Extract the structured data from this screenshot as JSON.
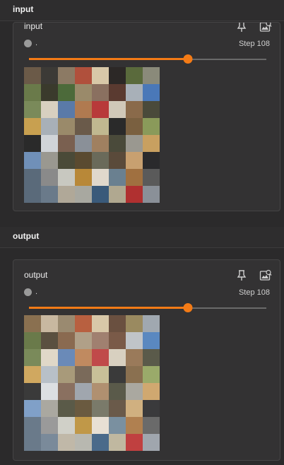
{
  "sections": [
    {
      "header": "input",
      "card": {
        "title": "input",
        "run_label": ".",
        "step_label": "Step 108",
        "slider_fraction": 0.67,
        "icons": [
          "pin-icon",
          "image-settings-icon"
        ],
        "tile_colors": [
          "#6b5a48",
          "#3c3a36",
          "#8c7a64",
          "#b0503c",
          "#d8c8a8",
          "#2c2826",
          "#5a6a3c",
          "#8a8a7a",
          "#6a7a4a",
          "#3a3a2c",
          "#4c6a3a",
          "#9a8a6a",
          "#8a7060",
          "#5a3a30",
          "#a8b0b8",
          "#4a78b8",
          "#7a8a5a",
          "#d8d0c0",
          "#5a7aa8",
          "#b07a50",
          "#b83a3a",
          "#d0c8b8",
          "#8a6a4a",
          "#4a4a3a",
          "#c8a050",
          "#a8b0b8",
          "#9a8a6a",
          "#6a5a4a",
          "#c0b890",
          "#2a2a2a",
          "#7a6040",
          "#8a9a5a",
          "#2a2a2a",
          "#d0d4d8",
          "#7a6050",
          "#8a9098",
          "#a08060",
          "#4a4a3a",
          "#9a9890",
          "#c8a060",
          "#7090b8",
          "#9a9890",
          "#4a4a38",
          "#5a4a30",
          "#6a6a5a",
          "#5a4a3a",
          "#c8a070",
          "#2a2a2c",
          "#5a6a7a",
          "#8a8a8a",
          "#c8c8c0",
          "#b88838",
          "#e0d8cc",
          "#6a8090",
          "#a07040",
          "#5a5a5a",
          "#5a6a7a",
          "#6a7a8a",
          "#b0a898",
          "#a8a8a0",
          "#3a5a7a",
          "#b0a890",
          "#b03030",
          "#8a9098"
        ]
      }
    },
    {
      "header": "output",
      "card": {
        "title": "output",
        "run_label": ".",
        "step_label": "Step 108",
        "slider_fraction": 0.67,
        "icons": [
          "pin-icon",
          "image-settings-icon"
        ],
        "tile_colors": [
          "#8a7050",
          "#c8b8a0",
          "#9a8a70",
          "#b86040",
          "#d8c8a8",
          "#6a5040",
          "#9a8a60",
          "#a0a8b0",
          "#6a7a4a",
          "#5a5040",
          "#8a6a50",
          "#b0a088",
          "#a08070",
          "#7a5a48",
          "#c0c4c8",
          "#5a88c0",
          "#7a8a5a",
          "#e0d8c8",
          "#6a8ab8",
          "#c08a60",
          "#c04a4a",
          "#d8d0c0",
          "#9a7a5a",
          "#5a5a4a",
          "#d0a860",
          "#b8c0c8",
          "#a89a7a",
          "#7a6a5a",
          "#c8c098",
          "#3a3a3a",
          "#8a7050",
          "#9aaa6a",
          "#3a3a3a",
          "#dcdfe2",
          "#8a7060",
          "#a0a6ae",
          "#b09070",
          "#5a5a4a",
          "#aaa8a0",
          "#d0a870",
          "#80a0c8",
          "#aaa8a0",
          "#5a5a48",
          "#6a5a40",
          "#7a7a6a",
          "#6a5a4a",
          "#d0b080",
          "#3a3a3c",
          "#6a7a8a",
          "#9a9a9a",
          "#d0d0c8",
          "#c09848",
          "#e8e0d4",
          "#7a90a0",
          "#b08050",
          "#6a6a6a",
          "#6a7a8a",
          "#7a8a9a",
          "#c0b8a8",
          "#b8b8b0",
          "#4a6a8a",
          "#c0b8a0",
          "#c04040",
          "#a0a6ae"
        ]
      }
    }
  ]
}
